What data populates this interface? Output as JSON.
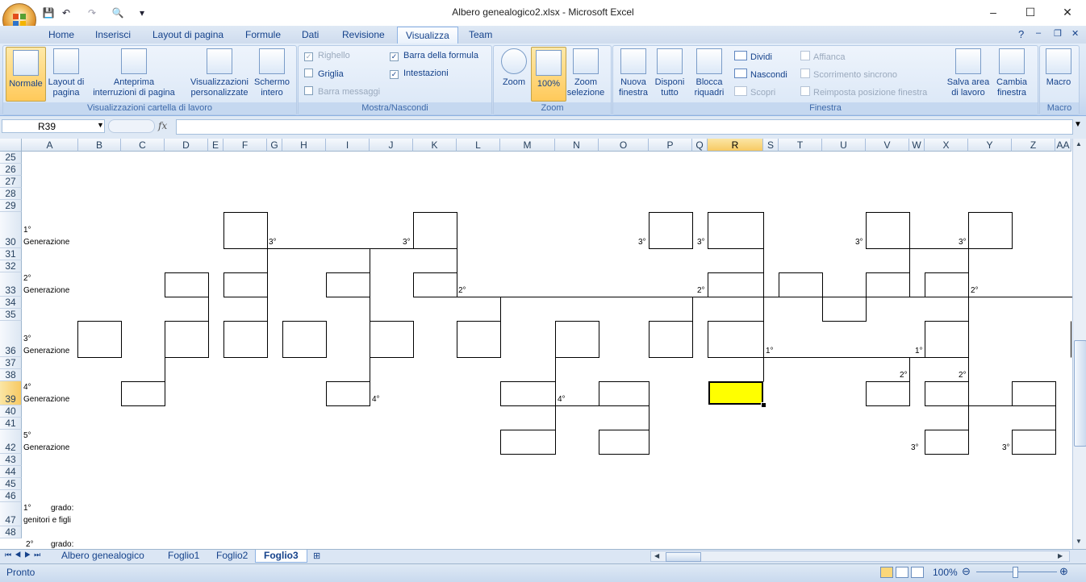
{
  "window": {
    "title": "Albero genealogico2.xlsx - Microsoft Excel",
    "minimize": "–",
    "maximize": "☐",
    "close": "✕"
  },
  "qat": {
    "save": "💾",
    "undo": "↶",
    "redo": "↷",
    "preview": "🔍",
    "customize": "▾"
  },
  "ribbon_tabs": [
    "Home",
    "Inserisci",
    "Layout di pagina",
    "Formule",
    "Dati",
    "Revisione",
    "Visualizza",
    "Team"
  ],
  "active_tab": "Visualizza",
  "groups": {
    "views": {
      "label": "Visualizzazioni cartella di lavoro",
      "normal": "Normale",
      "page_layout": [
        "Layout di",
        "pagina"
      ],
      "page_break": [
        "Anteprima",
        "interruzioni di pagina"
      ],
      "custom_views": [
        "Visualizzazioni",
        "personalizzate"
      ],
      "full_screen": [
        "Schermo",
        "intero"
      ]
    },
    "show_hide": {
      "label": "Mostra/Nascondi",
      "ruler": "Righello",
      "gridlines": "Griglia",
      "message_bar": "Barra messaggi",
      "formula_bar": "Barra della formula",
      "headings": "Intestazioni",
      "checked_mark": "✓"
    },
    "zoom": {
      "label": "Zoom",
      "zoom": "Zoom",
      "hundred": "100%",
      "zoom_selection": [
        "Zoom",
        "selezione"
      ]
    },
    "window": {
      "label": "Finestra",
      "new_window": [
        "Nuova",
        "finestra"
      ],
      "arrange_all": [
        "Disponi",
        "tutto"
      ],
      "freeze_panes": [
        "Blocca",
        "riquadri"
      ],
      "split": "Dividi",
      "hide": "Nascondi",
      "unhide": "Scopri",
      "side_by_side": "Affianca",
      "sync_scroll": "Scorrimento sincrono",
      "reset_position": "Reimposta posizione finestra",
      "save_workspace": [
        "Salva area",
        "di lavoro"
      ],
      "switch_windows": [
        "Cambia",
        "finestra"
      ]
    },
    "macro": {
      "label": "Macro",
      "macro": "Macro"
    }
  },
  "formula_bar": {
    "name_box": "R39",
    "fx": "fx",
    "value": ""
  },
  "columns": [
    "A",
    "B",
    "C",
    "D",
    "E",
    "F",
    "G",
    "H",
    "I",
    "J",
    "K",
    "L",
    "M",
    "N",
    "O",
    "P",
    "Q",
    "R",
    "S",
    "T",
    "U",
    "V",
    "W",
    "X",
    "Y",
    "Z",
    "AA"
  ],
  "selected_column": "R",
  "rows": [
    "25",
    "26",
    "27",
    "28",
    "29",
    "30",
    "31",
    "32",
    "33",
    "34",
    "35",
    "36",
    "37",
    "38",
    "39",
    "40",
    "41",
    "42",
    "43",
    "44",
    "45",
    "46",
    "47",
    "48"
  ],
  "selected_row": "39",
  "cell_texts": {
    "gen1_num": "1°",
    "gen1_label": "Generazione",
    "gen2_num": "2°",
    "gen2_label": "Generazione",
    "gen3_num": "3°",
    "gen3_label": "Generazione",
    "gen4_num": "4°",
    "gen4_label": "Generazione",
    "gen5_num": "5°",
    "gen5_label": "Generazione",
    "deg1_num": "1°",
    "deg1_word": "grado:",
    "deg1_desc": "genitori e figli",
    "deg2_num": "2°",
    "deg2_word": "grado:",
    "d3": "3°",
    "d2": "2°",
    "d1": "1°",
    "d4": "4°"
  },
  "sheet_tabs": [
    "Albero genealogico",
    "Foglio1",
    "Foglio2",
    "Foglio3"
  ],
  "active_sheet": "Foglio3",
  "status": {
    "ready": "Pronto",
    "zoom": "100%"
  },
  "colors": {
    "selected_fill": "#FFFF00",
    "ribbon_accent": "#15428B"
  }
}
